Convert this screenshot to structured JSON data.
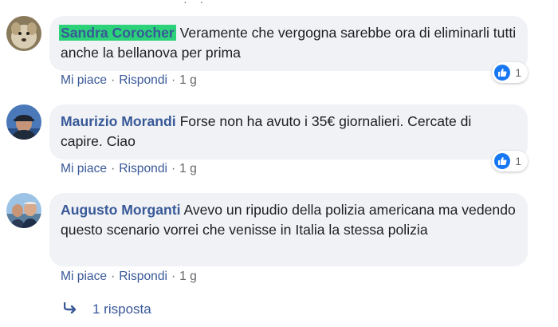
{
  "comments": [
    {
      "author": "Sandra Corocher",
      "text": "Veramente che vergogna sarebbe ora di eliminarli tutti anche la bellanova per prima",
      "like_label": "Mi piace",
      "reply_label": "Rispondi",
      "time": "1 g",
      "reaction_count": "1",
      "avatar_icon": "dog-photo"
    },
    {
      "author": "Maurizio Morandi",
      "text": "Forse non ha avuto i 35€ giornalieri. Cercate di capire. Ciao",
      "like_label": "Mi piace",
      "reply_label": "Rispondi",
      "time": "1 g",
      "reaction_count": "1",
      "avatar_icon": "man-in-cap-photo"
    },
    {
      "author": "Augusto Morganti",
      "text": "Avevo un ripudio della polizia americana ma vedendo questo scenario vorrei che venisse in Italia la stessa polizia",
      "like_label": "Mi piace",
      "reply_label": "Rispondi",
      "time": "1 g",
      "avatar_icon": "man-outdoors-photo"
    }
  ],
  "replies": {
    "label": "1 risposta",
    "icon": "reply-arrow-icon"
  },
  "colors": {
    "link": "#385898",
    "meta": "#65676b",
    "bubble": "#f0f2f5",
    "highlight": "#2bd27a",
    "like": "#1877f2"
  }
}
